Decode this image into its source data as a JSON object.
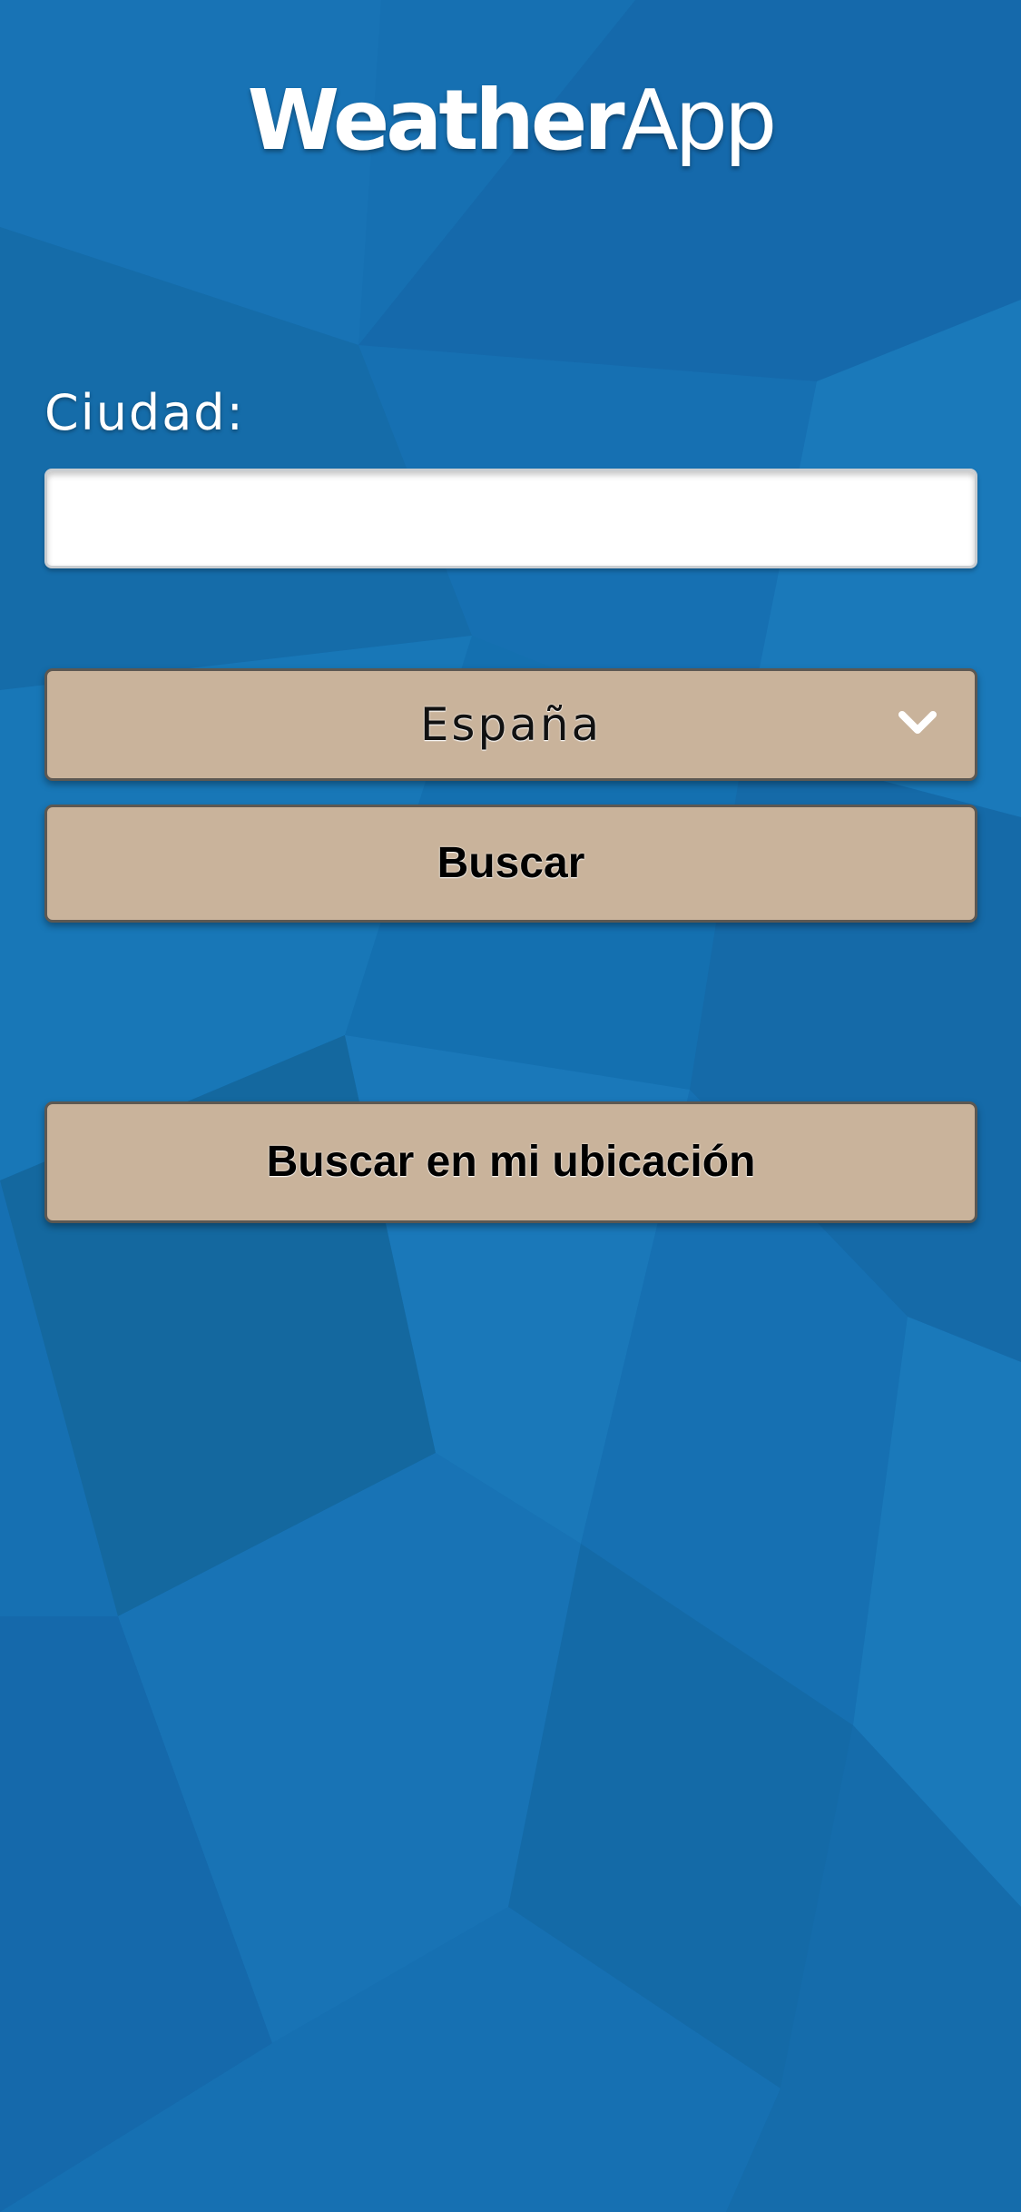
{
  "header": {
    "title_bold": "Weather",
    "title_light": "App"
  },
  "form": {
    "city_label": "Ciudad:",
    "city_value": "",
    "country_selected": "España",
    "search_label": "Buscar",
    "location_search_label": "Buscar en mi ubicación"
  },
  "icons": {
    "dropdown": "chevron-down-icon"
  },
  "colors": {
    "background": "#1670b2",
    "button": "#c9b39b",
    "button_border": "#5c5852",
    "text_on_blue": "#ffffff"
  }
}
